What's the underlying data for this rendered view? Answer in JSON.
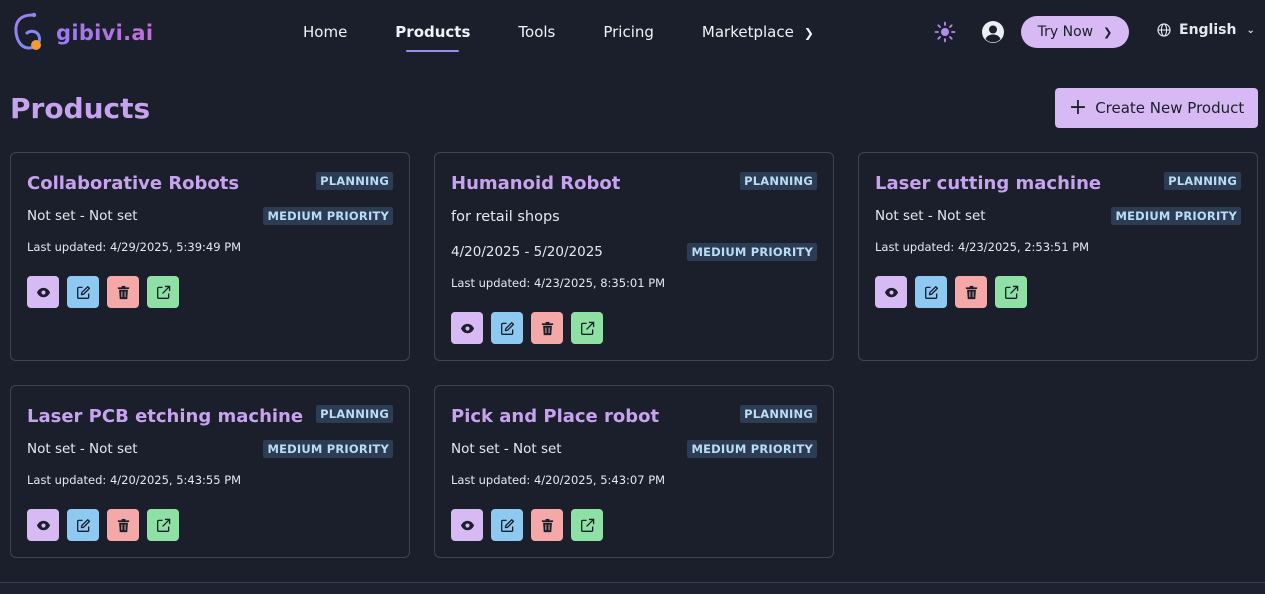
{
  "brand": {
    "name": "gibivi.ai",
    "colors": {
      "accent": "#c7a3ef",
      "button": "#d7b9f4",
      "badge_bg": "#2c3c52",
      "badge_text": "#b9ddf6"
    }
  },
  "nav": {
    "links": [
      {
        "label": "Home"
      },
      {
        "label": "Products"
      },
      {
        "label": "Tools"
      },
      {
        "label": "Pricing"
      },
      {
        "label": "Marketplace"
      }
    ],
    "active": "Products",
    "try_now": "Try Now",
    "language": "English",
    "icons": [
      "sun-icon",
      "user-circle-icon",
      "globe-icon",
      "chevron-right-icon",
      "chevron-down-icon"
    ]
  },
  "page": {
    "title": "Products",
    "create_button": "Create New Product"
  },
  "products": [
    {
      "name": "Collaborative Robots",
      "status": "PLANNING",
      "priority": "MEDIUM PRIORITY",
      "description": "",
      "dates": "Not set - Not set",
      "updated": "Last updated: 4/29/2025, 5:39:49 PM"
    },
    {
      "name": "Humanoid Robot",
      "status": "PLANNING",
      "priority": "MEDIUM PRIORITY",
      "description": "for retail shops",
      "dates": "4/20/2025 - 5/20/2025",
      "updated": "Last updated: 4/23/2025, 8:35:01 PM"
    },
    {
      "name": "Laser cutting machine",
      "status": "PLANNING",
      "priority": "MEDIUM PRIORITY",
      "description": "",
      "dates": "Not set - Not set",
      "updated": "Last updated: 4/23/2025, 2:53:51 PM"
    },
    {
      "name": "Laser PCB etching machine",
      "status": "PLANNING",
      "priority": "MEDIUM PRIORITY",
      "description": "",
      "dates": "Not set - Not set",
      "updated": "Last updated: 4/20/2025, 5:43:55 PM"
    },
    {
      "name": "Pick and Place robot",
      "status": "PLANNING",
      "priority": "MEDIUM PRIORITY",
      "description": "",
      "dates": "Not set - Not set",
      "updated": "Last updated: 4/20/2025, 5:43:07 PM"
    }
  ],
  "card_actions": [
    "eye-icon",
    "edit-icon",
    "trash-icon",
    "external-link-icon"
  ]
}
